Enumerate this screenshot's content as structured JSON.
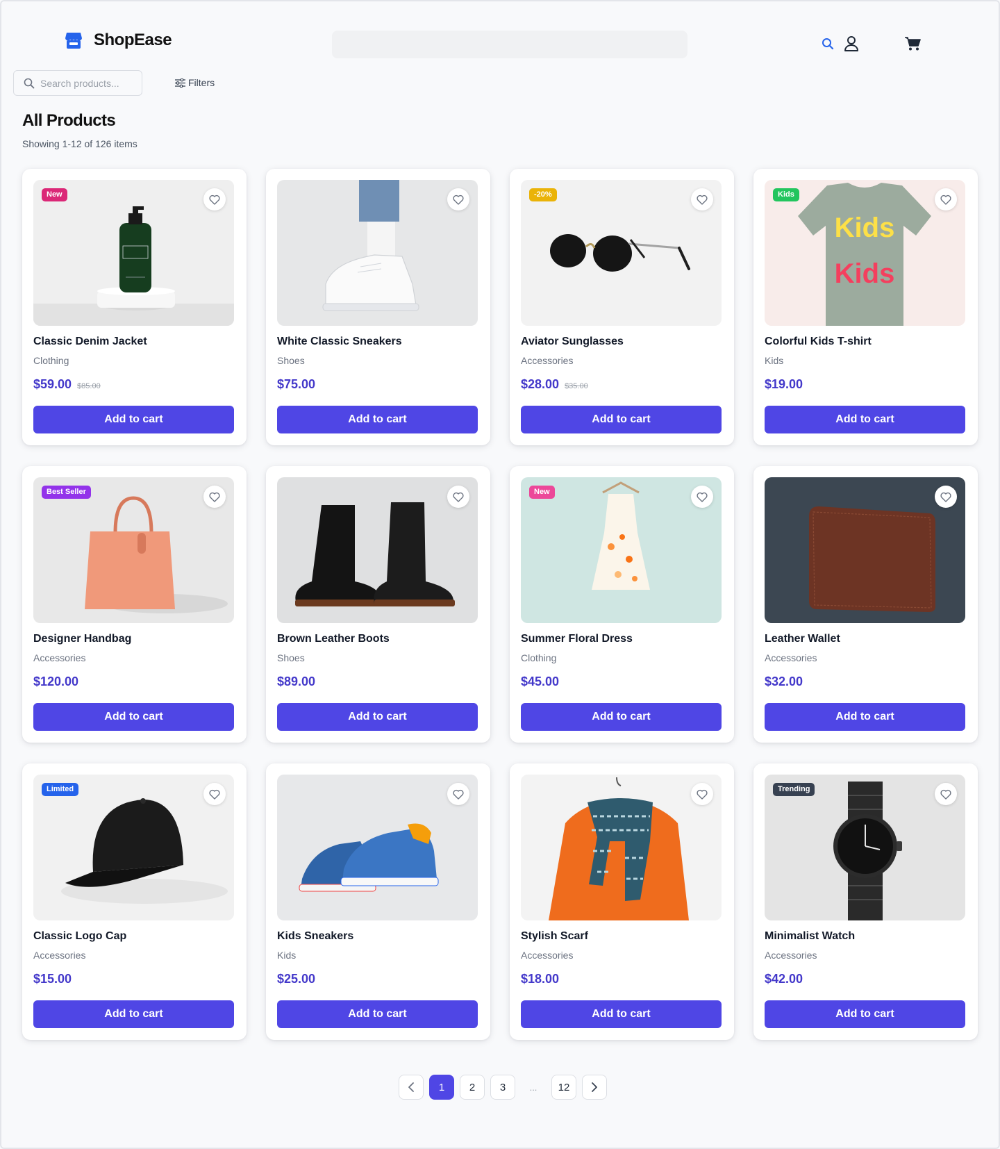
{
  "brand": {
    "name": "ShopEase"
  },
  "search": {
    "placeholder": "Search products..."
  },
  "filters": {
    "label": "Filters"
  },
  "page": {
    "title": "All Products",
    "subtitle": "Showing 1-12 of 126 items"
  },
  "colors": {
    "accent": "#4f46e5",
    "price": "#4338ca",
    "brand_icon": "#2563eb"
  },
  "products": [
    {
      "name": "Classic Denim Jacket",
      "category": "Clothing",
      "price": "$59.00",
      "old_price": "$85.00",
      "badge": "New",
      "badge_color": "#db2777",
      "button": "Add to cart",
      "image": "green-bottle-icon"
    },
    {
      "name": "White Classic Sneakers",
      "category": "Shoes",
      "price": "$75.00",
      "old_price": "",
      "badge": "",
      "badge_color": "",
      "button": "Add to cart",
      "image": "white-sneaker-icon"
    },
    {
      "name": "Aviator Sunglasses",
      "category": "Accessories",
      "price": "$28.00",
      "old_price": "$35.00",
      "badge": "-20%",
      "badge_color": "#eab308",
      "button": "Add to cart",
      "image": "sunglasses-icon"
    },
    {
      "name": "Colorful Kids T-shirt",
      "category": "Kids",
      "price": "$19.00",
      "old_price": "",
      "badge": "Kids",
      "badge_color": "#22c55e",
      "button": "Add to cart",
      "image": "kids-tshirt-icon"
    },
    {
      "name": "Designer Handbag",
      "category": "Accessories",
      "price": "$120.00",
      "old_price": "",
      "badge": "Best Seller",
      "badge_color": "#9333ea",
      "button": "Add to cart",
      "image": "handbag-icon"
    },
    {
      "name": "Brown Leather Boots",
      "category": "Shoes",
      "price": "$89.00",
      "old_price": "",
      "badge": "",
      "badge_color": "",
      "button": "Add to cart",
      "image": "boots-icon"
    },
    {
      "name": "Summer Floral Dress",
      "category": "Clothing",
      "price": "$45.00",
      "old_price": "",
      "badge": "New",
      "badge_color": "#ec4899",
      "button": "Add to cart",
      "image": "dress-icon"
    },
    {
      "name": "Leather Wallet",
      "category": "Accessories",
      "price": "$32.00",
      "old_price": "",
      "badge": "",
      "badge_color": "",
      "button": "Add to cart",
      "image": "wallet-icon"
    },
    {
      "name": "Classic Logo Cap",
      "category": "Accessories",
      "price": "$15.00",
      "old_price": "",
      "badge": "Limited",
      "badge_color": "#2563eb",
      "button": "Add to cart",
      "image": "cap-icon"
    },
    {
      "name": "Kids Sneakers",
      "category": "Kids",
      "price": "$25.00",
      "old_price": "",
      "badge": "",
      "badge_color": "",
      "button": "Add to cart",
      "image": "kids-sneakers-icon"
    },
    {
      "name": "Stylish Scarf",
      "category": "Accessories",
      "price": "$18.00",
      "old_price": "",
      "badge": "",
      "badge_color": "",
      "button": "Add to cart",
      "image": "scarf-icon"
    },
    {
      "name": "Minimalist Watch",
      "category": "Accessories",
      "price": "$42.00",
      "old_price": "",
      "badge": "Trending",
      "badge_color": "#374151",
      "button": "Add to cart",
      "image": "watch-icon"
    }
  ],
  "pagination": {
    "pages": [
      "1",
      "2",
      "3",
      "12"
    ],
    "current": "1",
    "ellipsis": "..."
  }
}
